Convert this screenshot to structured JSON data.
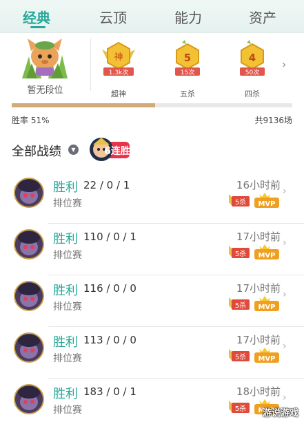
{
  "tabs": [
    "经典",
    "云顶",
    "能力",
    "资产"
  ],
  "rank": {
    "label": "暂无段位"
  },
  "medals": [
    {
      "glyph": "神",
      "count": "1.3k次",
      "name": "超神",
      "color": "#e8b530"
    },
    {
      "glyph": "5",
      "count": "15次",
      "name": "五杀",
      "color": "#e8b530"
    },
    {
      "glyph": "4",
      "count": "50次",
      "name": "四杀",
      "color": "#e8b530"
    }
  ],
  "stats": {
    "win_rate_text": "胜率 51%",
    "win_rate": 0.51,
    "total_text": "共9136场"
  },
  "section": {
    "title": "全部战绩",
    "streak_text": "6连胜"
  },
  "matches": [
    {
      "result": "胜利",
      "kda": "22 / 0 / 1",
      "mode": "排位赛",
      "time": "16小时前",
      "badge_pentakill": "5杀",
      "badge_mvp": "MVP"
    },
    {
      "result": "胜利",
      "kda": "110 / 0 / 1",
      "mode": "排位赛",
      "time": "17小时前",
      "badge_pentakill": "5杀",
      "badge_mvp": "MVP"
    },
    {
      "result": "胜利",
      "kda": "116 / 0 / 0",
      "mode": "排位赛",
      "time": "17小时前",
      "badge_pentakill": "5杀",
      "badge_mvp": "MVP"
    },
    {
      "result": "胜利",
      "kda": "113 / 0 / 0",
      "mode": "排位赛",
      "time": "17小时前",
      "badge_pentakill": "5杀",
      "badge_mvp": "MVP"
    },
    {
      "result": "胜利",
      "kda": "183 / 0 / 1",
      "mode": "排位赛",
      "time": "18小时前",
      "badge_pentakill": "5杀",
      "badge_mvp": "MVP"
    }
  ],
  "watermark": "游说游戏",
  "colors": {
    "accent": "#27a89a",
    "bar": "#d2a978",
    "badge_red": "#e04a3a",
    "badge_gold": "#f0a020"
  }
}
